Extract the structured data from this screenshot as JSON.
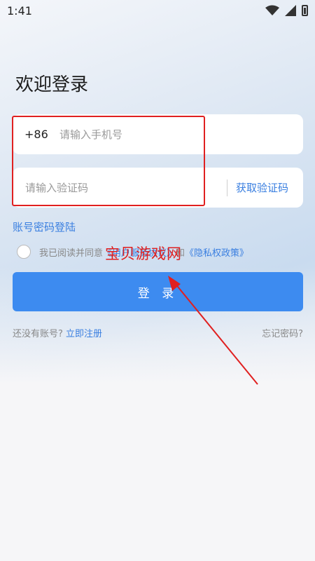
{
  "status_bar": {
    "time": "1:41"
  },
  "page": {
    "title": "欢迎登录"
  },
  "phone_field": {
    "country_code": "+86",
    "placeholder": "请输入手机号",
    "value": ""
  },
  "code_field": {
    "placeholder": "请输入验证码",
    "value": "",
    "get_code_label": "获取验证码"
  },
  "password_login_label": "账号密码登陆",
  "agreement": {
    "prefix": "我已阅读并同意",
    "user_agreement": "《用户服务协议》",
    "and": "和",
    "privacy_policy": "《隐私权政策》",
    "checked": false
  },
  "watermark": "宝贝游戏网",
  "login_button": "登 录",
  "bottom": {
    "no_account": "还没有账号?",
    "register": "立即注册",
    "forgot": "忘记密码?"
  },
  "colors": {
    "accent": "#3d8bf0",
    "link": "#3a7fe0",
    "highlight": "#e02020"
  }
}
